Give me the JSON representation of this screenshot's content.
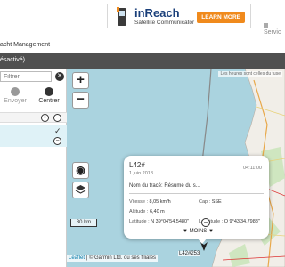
{
  "ad": {
    "title": "inReach",
    "subtitle": "Satellite Communicator",
    "button": "LEARN MORE"
  },
  "header": {
    "service_link": "Servic",
    "title": "acht Management"
  },
  "sidebar": {
    "status": "ésactivé)",
    "filter_placeholder": "Filtrer",
    "send_label": "Envoyer",
    "center_label": "Centrer"
  },
  "map": {
    "attribution_top": "Les heures sont celles du fuse",
    "zoom_in": "+",
    "zoom_out": "−",
    "scale": "30 km",
    "attribution_bottom_link": "Leaflet",
    "attribution_bottom_text": " | © Garmin Ltd. ou ses filiales",
    "marker_label": "L42#253"
  },
  "popup": {
    "title": "L42#",
    "date": "1 juin 2018",
    "time": "04:11:00",
    "track_name": "Nom du tracé: Résumé du s...",
    "speed_label": "Vitesse : ",
    "speed": "8,05 km/h",
    "heading_label": "Cap : ",
    "heading": "SSE",
    "altitude_label": "Altitude : ",
    "altitude": "6,40 m",
    "lat_label": "Latitude : ",
    "latitude": "N 39°04'54.5480\"",
    "lon_label": "Longitude : ",
    "longitude": "O 9°43'34.7988\"",
    "less": "▼ MOINS ▼"
  }
}
